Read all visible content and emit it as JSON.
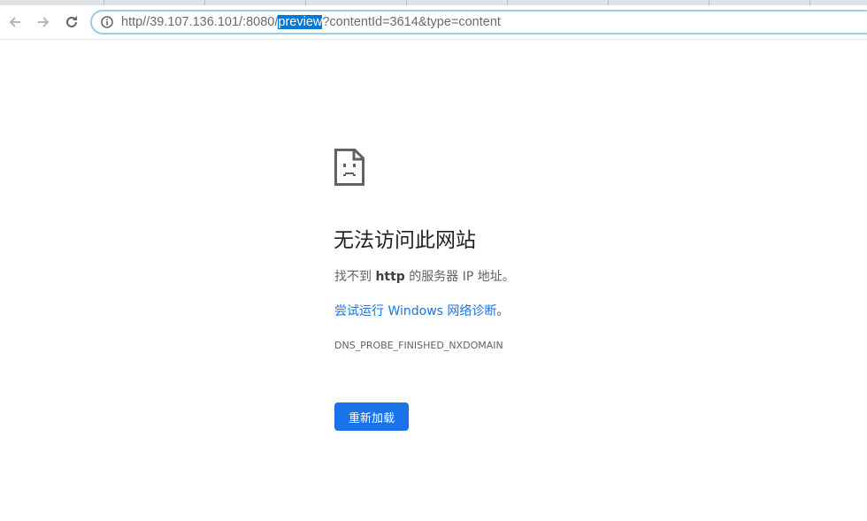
{
  "browser": {
    "back_icon": "arrow-left-icon",
    "forward_icon": "arrow-right-icon",
    "reload_icon": "reload-icon",
    "info_icon": "info-icon",
    "url": {
      "before": "http//39.107.136.101/:8080/",
      "selected": "preview",
      "after": "?contentId=3614&type=content"
    }
  },
  "error_page": {
    "icon": "sad-page-icon",
    "headline": "无法访问此网站",
    "desc_prefix": "找不到 ",
    "desc_host": "http",
    "desc_suffix": " 的服务器 IP 地址。",
    "suggest_link": "尝试运行 Windows 网络诊断",
    "suggest_end": "。",
    "error_code": "DNS_PROBE_FINISHED_NXDOMAIN",
    "reload_label": "重新加载"
  },
  "colors": {
    "accent": "#1a73e8",
    "selection": "#0078d7",
    "omnibox_border": "#9ccbea"
  }
}
